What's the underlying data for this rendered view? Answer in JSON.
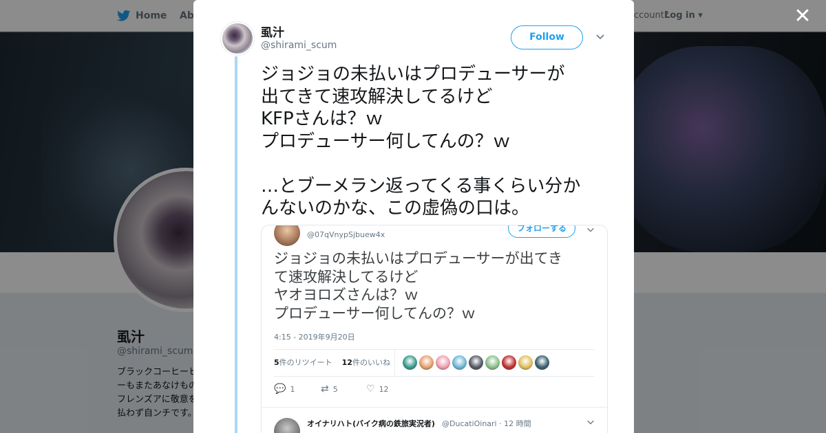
{
  "topbar": {
    "home_label": "Home",
    "about_label": "Abo",
    "account_text": "ccount?",
    "login_label": "Log in ▾"
  },
  "profile": {
    "name": "虱汁",
    "handle": "@shirami_scum",
    "bio": "ブラックコーヒーヒーもまたあなけものフレンズアに敬意を払わず自ンチです。"
  },
  "close_label": "✕",
  "tweet": {
    "author_name": "虱汁",
    "author_handle": "@shirami_scum",
    "follow_label": "Follow",
    "text": "ジョジョの未払いはプロデューサーが\n出てきて速攻解決してるけど\nKFPさんは？ｗ\nプロデューサー何してんの？ｗ\n\n…とブーメラン返ってくる事くらい分か\nんないのかな、この虚偽の口は。"
  },
  "embedded": {
    "handle": "@07qVnypSjbuew4x",
    "follow_label": "フォローする",
    "text": "ジョジョの未払いはプロデューサーが出てき\nて速攻解決してるけど\nヤオヨロズさんは？ｗ\nプロデューサー何してんの？ｗ",
    "timestamp": "4:15 - 2019年9月20日",
    "retweets_count": "5",
    "retweets_label": "件のリツイート",
    "likes_count": "12",
    "likes_label": "件のいいね",
    "reply_count": "1",
    "retweet_count_action": "5",
    "like_count_action": "12",
    "reply_author": "オイナリハト(バイク病の鉄旅実況者)",
    "reply_meta": "@DucatiOinari · 12 時間",
    "liker_colors": [
      "#3a9c8c",
      "#e8a070",
      "#f0a0b0",
      "#6fb8d8",
      "#555a66",
      "#8cc08c",
      "#c03030",
      "#e0c060",
      "#3a6070"
    ]
  },
  "icons": {
    "bird": "twitter-bird-icon",
    "caret": "chevron-down-icon",
    "reply": "reply-icon",
    "retweet": "retweet-icon",
    "like": "heart-icon"
  }
}
